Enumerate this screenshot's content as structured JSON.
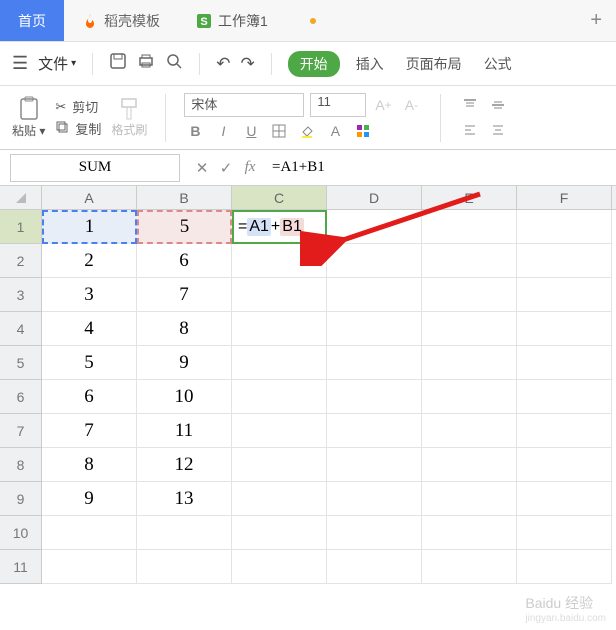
{
  "tabs": {
    "home": "首页",
    "docer": "稻壳模板",
    "workbook": "工作簿1"
  },
  "menu": {
    "file": "文件"
  },
  "ribbon": {
    "start": "开始",
    "insert": "插入",
    "layout": "页面布局",
    "formula_tab": "公式"
  },
  "clipboard": {
    "cut": "剪切",
    "copy": "复制",
    "paste": "粘贴",
    "format_painter": "格式刷"
  },
  "font": {
    "name": "宋体",
    "size": "11"
  },
  "namebox": "SUM",
  "formula": "=A1+B1",
  "cell_formula": {
    "prefix": "=",
    "ref1": "A1",
    "op": "+",
    "ref2": "B1"
  },
  "cols": [
    "A",
    "B",
    "C",
    "D",
    "E",
    "F"
  ],
  "rows": [
    {
      "n": 1,
      "A": "1",
      "B": "5"
    },
    {
      "n": 2,
      "A": "2",
      "B": "6"
    },
    {
      "n": 3,
      "A": "3",
      "B": "7"
    },
    {
      "n": 4,
      "A": "4",
      "B": "8"
    },
    {
      "n": 5,
      "A": "5",
      "B": "9"
    },
    {
      "n": 6,
      "A": "6",
      "B": "10"
    },
    {
      "n": 7,
      "A": "7",
      "B": "11"
    },
    {
      "n": 8,
      "A": "8",
      "B": "12"
    },
    {
      "n": 9,
      "A": "9",
      "B": "13"
    },
    {
      "n": 10,
      "A": "",
      "B": ""
    },
    {
      "n": 11,
      "A": "",
      "B": ""
    }
  ],
  "watermark": {
    "main": "Baidu 经验",
    "sub": "jingyan.baidu.com"
  }
}
